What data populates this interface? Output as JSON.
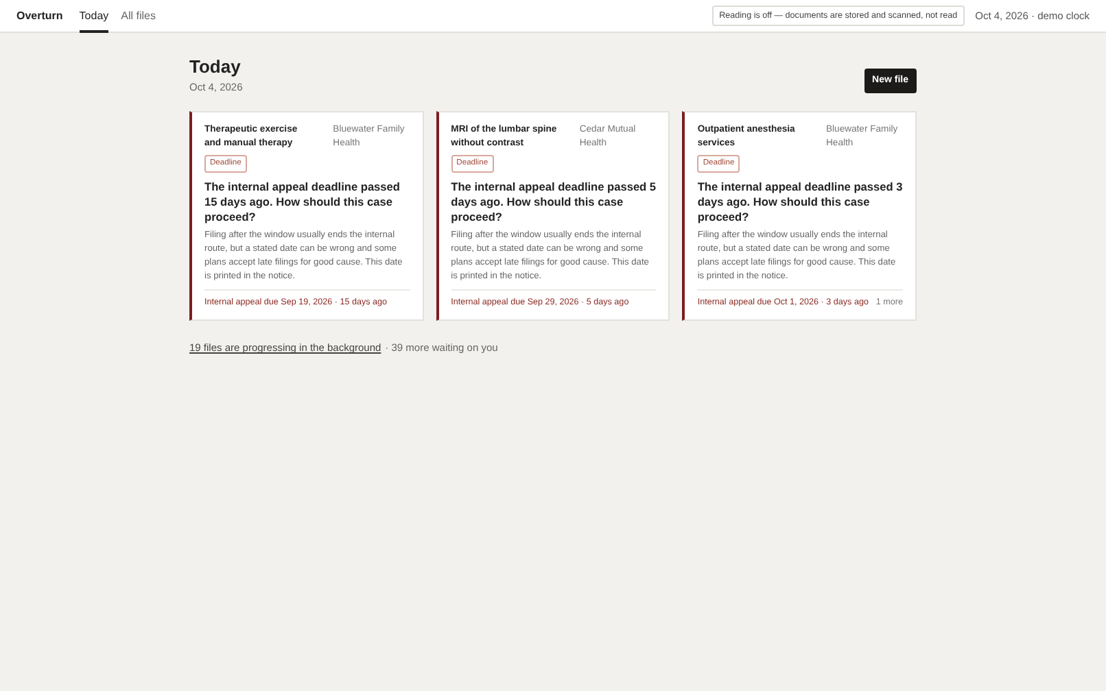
{
  "brand": "Overturn",
  "tabs": [
    {
      "label": "Today",
      "selected": true
    },
    {
      "label": "All files",
      "selected": false
    }
  ],
  "notice": "Reading is off — documents are stored and scanned, not read",
  "clock": "Oct 4, 2026 · demo clock",
  "heading": {
    "title": "Today",
    "date": "Oct 4, 2026"
  },
  "new_button": "New file",
  "cards": [
    {
      "service": "Therapeutic exercise and manual therapy",
      "payer": "Bluewater Family Health",
      "tag": "Deadline",
      "question": "The internal appeal deadline passed 15 days ago. How should this case proceed?",
      "body": "Filing after the window usually ends the internal route, but a stated date can be wrong and some plans accept late filings for good cause. This date is printed in the notice.",
      "due": "Internal appeal due Sep 19, 2026 · 15 days ago"
    },
    {
      "service": "MRI of the lumbar spine without contrast",
      "payer": "Cedar Mutual Health",
      "tag": "Deadline",
      "question": "The internal appeal deadline passed 5 days ago. How should this case proceed?",
      "body": "Filing after the window usually ends the internal route, but a stated date can be wrong and some plans accept late filings for good cause. This date is printed in the notice.",
      "due": "Internal appeal due Sep 29, 2026 · 5 days ago"
    },
    {
      "service": "Outpatient anesthesia services",
      "payer": "Bluewater Family Health",
      "tag": "Deadline",
      "question": "The internal appeal deadline passed 3 days ago. How should this case proceed?",
      "body": "Filing after the window usually ends the internal route, but a stated date can be wrong and some plans accept late filings for good cause. This date is printed in the notice.",
      "due": "Internal appeal due Oct 1, 2026 · 3 days ago",
      "more": "1 more"
    }
  ],
  "footer": {
    "link": "19 files are progressing in the background",
    "rest": "· 39 more waiting on you"
  }
}
